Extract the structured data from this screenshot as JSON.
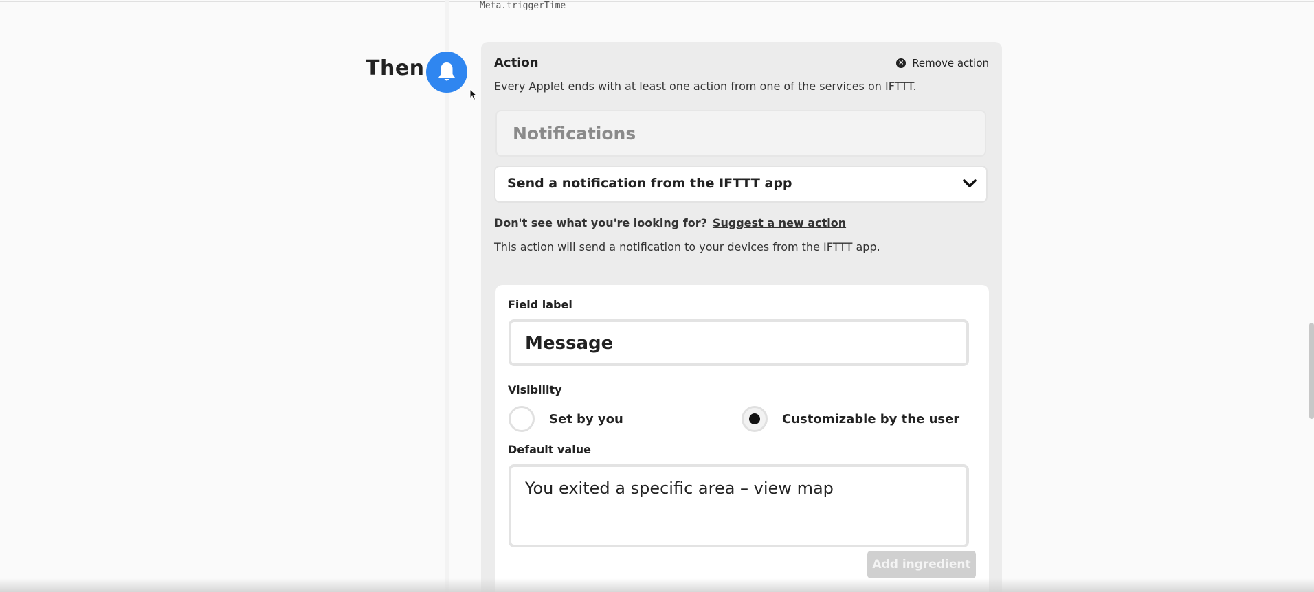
{
  "meta_ingredient": "Meta.triggerTime",
  "step": {
    "label": "Then"
  },
  "action": {
    "title": "Action",
    "remove_label": "Remove action",
    "description": "Every Applet ends with at least one action from one of the services on IFTTT.",
    "service_name": "Notifications",
    "selected_action": "Send a notification from the IFTTT app",
    "lookfor_text": "Don't see what you're looking for?",
    "suggest_link": "Suggest a new action",
    "info": "This action will send a notification to your devices from the IFTTT app."
  },
  "field": {
    "label_title": "Field label",
    "label_value": "Message",
    "visibility_title": "Visibility",
    "visibility_options": [
      {
        "label": "Set by you",
        "selected": false
      },
      {
        "label": "Customizable by the user",
        "selected": true
      }
    ],
    "default_title": "Default value",
    "default_value": "You exited a specific area – view map",
    "add_ingredient_label": "Add ingredient"
  },
  "colors": {
    "accent_blue": "#2f86f0",
    "panel_bg": "#ececec",
    "disabled_button": "#d0d0d0"
  }
}
